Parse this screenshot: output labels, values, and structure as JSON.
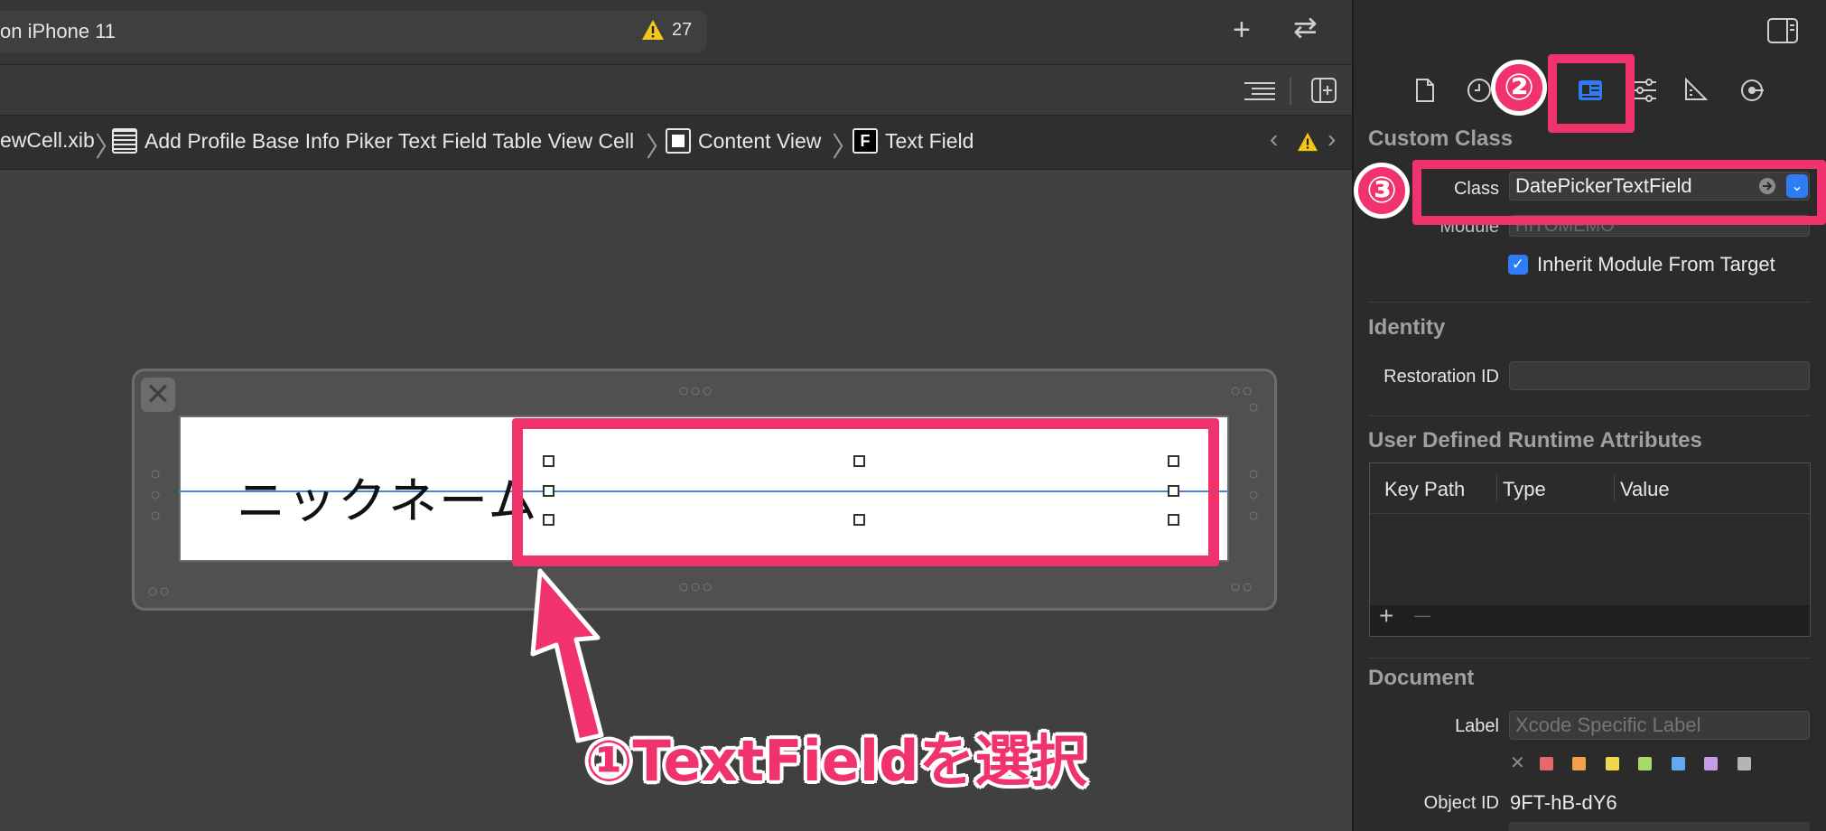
{
  "toolbar": {
    "scheme_text": "on iPhone 11",
    "warning_count": "27"
  },
  "breadcrumb": {
    "items": [
      "ewCell.xib",
      "Add Profile Base Info Piker Text Field Table View Cell",
      "Content View",
      "Text Field"
    ]
  },
  "canvas": {
    "nickname_label": "ニックネーム"
  },
  "annotations": {
    "step1_caption": "①TextFieldを選択",
    "step2": "②",
    "step3": "③"
  },
  "inspector": {
    "custom_class": {
      "title": "Custom Class",
      "class_label": "Class",
      "class_value": "DatePickerTextField",
      "module_label": "Module",
      "module_value": "HITOMEMO",
      "inherit_label": "Inherit Module From Target"
    },
    "identity": {
      "title": "Identity",
      "restoration_label": "Restoration ID",
      "restoration_value": ""
    },
    "runtime_attributes": {
      "title": "User Defined Runtime Attributes",
      "columns": [
        "Key Path",
        "Type",
        "Value"
      ],
      "add": "+",
      "remove": "—"
    },
    "document": {
      "title": "Document",
      "label_label": "Label",
      "label_placeholder": "Xcode Specific Label",
      "object_id_label": "Object ID",
      "object_id_value": "9FT-hB-dY6"
    }
  },
  "colors": {
    "annotation": "#f1336d",
    "accent_blue": "#2f7df6",
    "swatches": [
      "#e46a6a",
      "#f0a14a",
      "#f2d64d",
      "#a6d86a",
      "#63a9ee",
      "#c79be6",
      "#b5b5b5"
    ]
  }
}
